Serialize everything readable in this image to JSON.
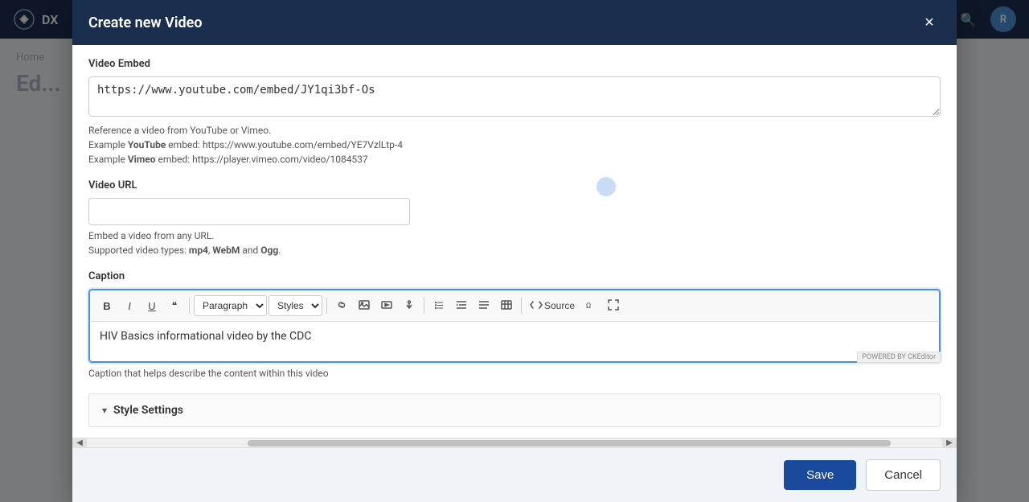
{
  "app": {
    "name": "DX",
    "avatar_letter": "R"
  },
  "background": {
    "breadcrumb": "Home",
    "page_title": "Ed..."
  },
  "modal": {
    "title": "Create new Video",
    "close_label": "×",
    "sections": {
      "video_embed": {
        "label": "Video Embed",
        "placeholder": "https://www.youtube.com/embed/JY1qi3bf-Os",
        "value": "https://www.youtube.com/embed/JY1qi3bf-Os",
        "help_line1": "Reference a video from YouTube or Vimeo.",
        "help_line2_prefix": "Example ",
        "help_youtube": "YouTube",
        "help_line2_mid": " embed: https://www.youtube.com/embed/YE7VzlLtp-4",
        "help_line3_prefix": "Example ",
        "help_vimeo": "Vimeo",
        "help_line3_mid": " embed: https://player.vimeo.com/video/1084537"
      },
      "video_url": {
        "label": "Video URL",
        "placeholder": "",
        "value": "",
        "help_line1": "Embed a video from any URL.",
        "help_line2_pre": "Supported video types: ",
        "help_mp4": "mp4",
        "help_webm": "WebM",
        "help_ogg": "Ogg",
        "help_line2_end": "."
      },
      "caption": {
        "label": "Caption",
        "toolbar": {
          "bold": "B",
          "italic": "I",
          "underline": "U",
          "blockquote": "❝",
          "paragraph_label": "Paragraph",
          "styles_label": "Styles",
          "link": "🔗",
          "source_label": "Source"
        },
        "content": "HIV Basics informational video by the CDC",
        "help_text": "Caption that helps describe the content within this video",
        "ckeditor_badge": "POWERED BY CKEditor"
      },
      "style_settings": {
        "label": "Style Settings",
        "collapsed": true
      }
    },
    "footer": {
      "save_label": "Save",
      "cancel_label": "Cancel"
    }
  }
}
